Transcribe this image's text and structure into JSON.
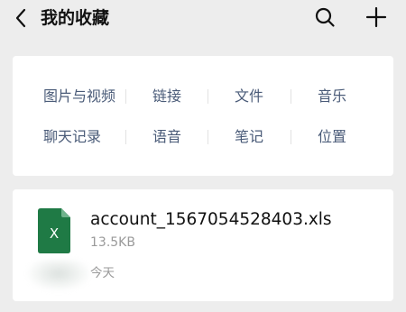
{
  "header": {
    "title": "我的收藏",
    "back_icon": "chevron-left-icon",
    "search_icon": "search-icon",
    "add_icon": "plus-icon"
  },
  "categories": {
    "row1": [
      "图片与视频",
      "链接",
      "文件",
      "音乐"
    ],
    "row2": [
      "聊天记录",
      "语音",
      "笔记",
      "位置"
    ]
  },
  "favorites": [
    {
      "file_name": "account_1567054528403.xls",
      "file_size": "13.5KB",
      "date": "今天",
      "icon": "excel-file-icon",
      "icon_letter": "X",
      "icon_color": "#1f7a45"
    }
  ],
  "colors": {
    "background": "#ededed",
    "category_text": "#4a5b78",
    "meta_text": "#9a9a9a"
  }
}
